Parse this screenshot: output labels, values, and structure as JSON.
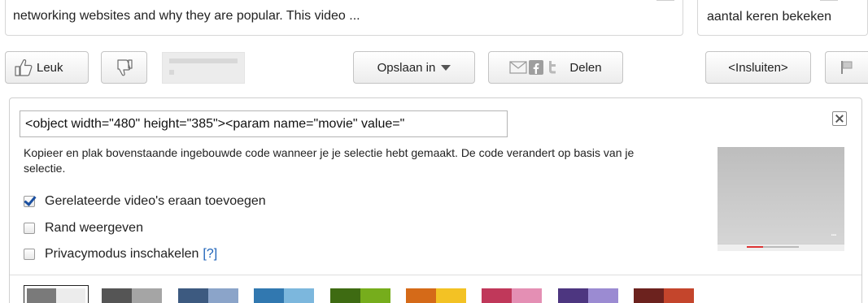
{
  "description": {
    "text": "networking websites and why they are popular. This video ..."
  },
  "stats": {
    "views_label": "aantal keren bekeken"
  },
  "actions": {
    "like_label": "Leuk",
    "save_label": "Opslaan in",
    "share_label": "Delen",
    "embed_label": "<Insluiten>"
  },
  "embed": {
    "code_value": "<object width=\"480\" height=\"385\"><param name=\"movie\" value=\"",
    "instructions": "Kopieer en plak bovenstaande ingebouwde code wanneer je je selectie hebt gemaakt. De code verandert op basis van je selectie.",
    "options": [
      {
        "label": "Gerelateerde video's eraan toevoegen",
        "checked": true
      },
      {
        "label": "Rand weergeven",
        "checked": false
      },
      {
        "label": "Privacymodus inschakelen",
        "checked": false,
        "help": "[?]"
      }
    ]
  },
  "colors": {
    "link": "#1c62b9",
    "checkmark": "#1a4fa0",
    "swatches": [
      [
        "#7a7a7a",
        "#ececec"
      ],
      [
        "#555555",
        "#a5a5a5"
      ],
      [
        "#3d5a80",
        "#8ba4c9"
      ],
      [
        "#3178b0",
        "#7cb7dd"
      ],
      [
        "#3e6b12",
        "#76ad1c"
      ],
      [
        "#d56a18",
        "#f3c224"
      ],
      [
        "#c0385a",
        "#e48fb4"
      ],
      [
        "#4d3680",
        "#9b8bd2"
      ],
      [
        "#6c221e",
        "#c4452c"
      ]
    ],
    "selected_swatch": 0
  }
}
